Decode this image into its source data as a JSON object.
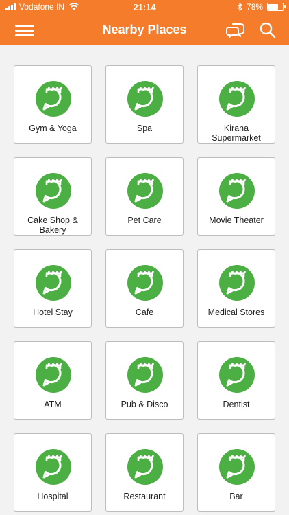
{
  "status": {
    "carrier": "Vodafone IN",
    "time": "21:14",
    "battery": "78%",
    "battery_level": 0.78
  },
  "header": {
    "title": "Nearby Places"
  },
  "colors": {
    "accent": "#f47c2b",
    "icon_green": "#4caf43"
  },
  "icons": {
    "menu": "hamburger-menu-icon",
    "chat": "chat-bubbles-icon",
    "search": "search-icon",
    "category": "azzt-logo-icon"
  },
  "categories": [
    {
      "label": "Gym & Yoga"
    },
    {
      "label": "Spa"
    },
    {
      "label": "Kirana Supermarket"
    },
    {
      "label": "Cake Shop & Bakery"
    },
    {
      "label": "Pet Care"
    },
    {
      "label": "Movie Theater"
    },
    {
      "label": "Hotel Stay"
    },
    {
      "label": "Cafe"
    },
    {
      "label": "Medical Stores"
    },
    {
      "label": "ATM"
    },
    {
      "label": "Pub & Disco"
    },
    {
      "label": "Dentist"
    },
    {
      "label": "Hospital"
    },
    {
      "label": "Restaurant"
    },
    {
      "label": "Bar"
    }
  ]
}
